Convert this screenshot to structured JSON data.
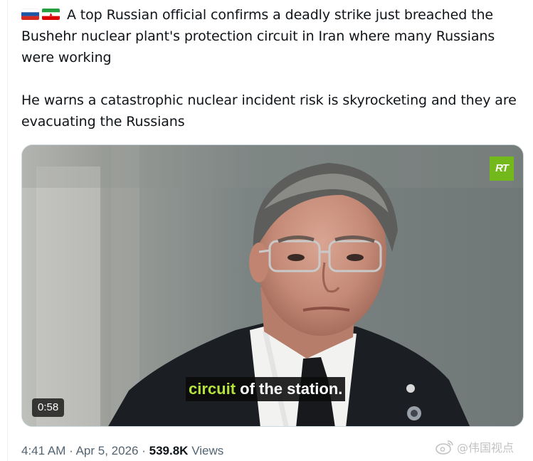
{
  "tweet": {
    "flags": [
      "russia-flag",
      "iran-flag"
    ],
    "paragraph_1": "A top Russian official confirms a deadly strike just breached the Bushehr nuclear plant's protection circuit in Iran where many Russians were working",
    "paragraph_2": "He warns a catastrophic nuclear incident risk is skyrocketing and they are evacuating the Russians"
  },
  "video": {
    "channel_logo": "RT",
    "subtitle_highlight": "circuit",
    "subtitle_rest": "of the station.",
    "duration": "0:58"
  },
  "meta": {
    "time": "4:41 AM",
    "separator": "·",
    "date": "Apr 5, 2026",
    "views_count": "539.8K",
    "views_label": "Views"
  },
  "watermark": {
    "text": "@伟国视点",
    "icon": "weibo-icon"
  },
  "colors": {
    "text_primary": "#0f1419",
    "text_secondary": "#536471",
    "rt_green": "#74b91c",
    "subtitle_highlight": "#b5e23b"
  }
}
